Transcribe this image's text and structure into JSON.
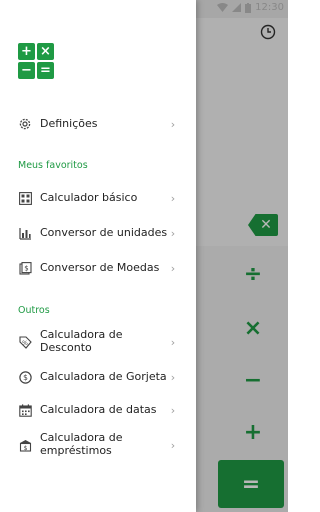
{
  "status_bar": {
    "time": "12:30"
  },
  "app_background": {
    "keys": [
      "÷",
      "×",
      "−",
      "+"
    ],
    "equals_label": "=",
    "backspace_icon": "backspace-icon",
    "history_icon": "clock-icon"
  },
  "drawer": {
    "logo": {
      "cells": [
        "+",
        "×",
        "−",
        "="
      ]
    },
    "settings": {
      "label": "Definições",
      "icon": "gear-icon"
    },
    "favorites": {
      "header": "Meus favoritos",
      "items": [
        {
          "label": "Calculador básico",
          "icon": "calculator-icon"
        },
        {
          "label": "Conversor de unidades",
          "icon": "ruler-icon"
        },
        {
          "label": "Conversor de Moedas",
          "icon": "currency-icon"
        }
      ]
    },
    "others": {
      "header": "Outros",
      "items": [
        {
          "label": "Calculadora de Desconto",
          "icon": "discount-tag-icon"
        },
        {
          "label": "Calculadora de Gorjeta",
          "icon": "dollar-coin-icon"
        },
        {
          "label": "Calculadora de datas",
          "icon": "calendar-icon"
        },
        {
          "label": "Calculadora de empréstimos",
          "icon": "loan-icon"
        }
      ]
    }
  },
  "colors": {
    "accent": "#1f9a44",
    "text": "#222222",
    "chevron": "#9e9e9e"
  }
}
